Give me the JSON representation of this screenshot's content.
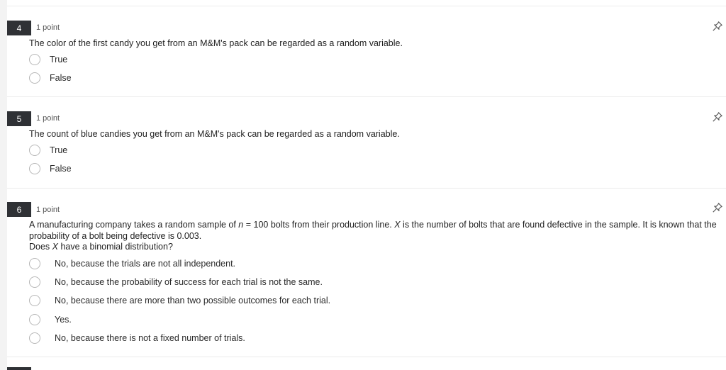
{
  "questions": [
    {
      "number": "4",
      "points": "1 point",
      "prompt": "The color of the first candy you get from an M&M's pack can be regarded as a random variable.",
      "options": [
        "True",
        "False"
      ]
    },
    {
      "number": "5",
      "points": "1 point",
      "prompt": "The count of blue candies you get from an M&M's pack can be regarded as a random variable.",
      "options": [
        "True",
        "False"
      ]
    },
    {
      "number": "6",
      "points": "1 point",
      "prompt_parts": {
        "a": "A manufacturing company takes a random sample of ",
        "n_var": "n",
        "b": " = 100 bolts from their production line. ",
        "x_var": "X",
        "c": " is the number of bolts that are found defective in the sample. It is known that the probability of a bolt being defective is 0.003.",
        "d": "Does ",
        "x_var2": "X",
        "e": " have a binomial distribution?"
      },
      "options": [
        "No, because the trials are not all independent.",
        "No, because the probability of success for each trial is not the same.",
        "No, because there are more than two possible outcomes for each trial.",
        "Yes.",
        "No, because there is not a fixed number of trials."
      ]
    }
  ],
  "icons": {
    "pin": "pin-icon"
  }
}
